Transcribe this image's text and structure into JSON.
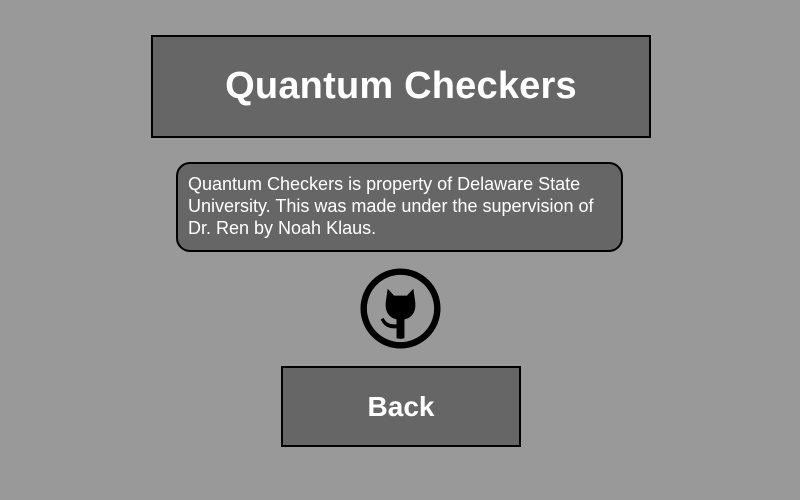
{
  "title": "Quantum Checkers",
  "info": {
    "text": "Quantum Checkers is property of Delaware State University. This was made under the supervision of Dr. Ren by Noah Klaus."
  },
  "github_icon": "github-icon",
  "back_button": {
    "label": "Back"
  },
  "colors": {
    "background": "#999999",
    "panel": "#666666",
    "border": "#000000",
    "text": "#ffffff"
  }
}
